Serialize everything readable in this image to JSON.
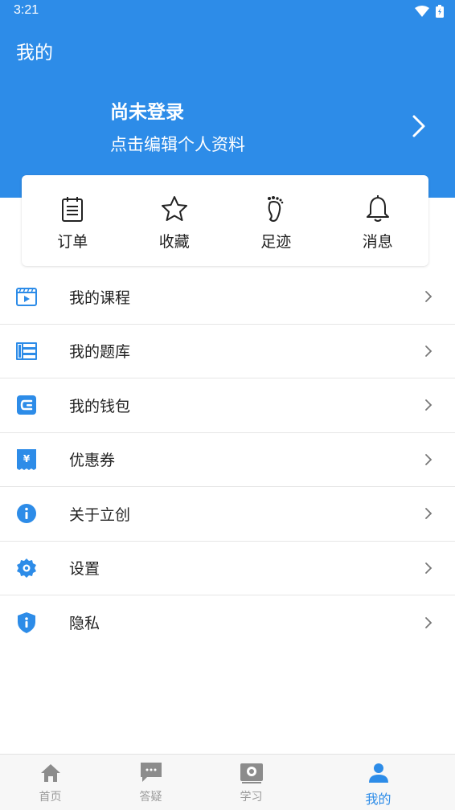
{
  "status": {
    "time": "3:21"
  },
  "header": {
    "title": "我的"
  },
  "profile": {
    "name": "尚未登录",
    "subtitle": "点击编辑个人资料"
  },
  "quick": [
    {
      "label": "订单",
      "icon": "order-icon"
    },
    {
      "label": "收藏",
      "icon": "star-icon"
    },
    {
      "label": "足迹",
      "icon": "footprint-icon"
    },
    {
      "label": "消息",
      "icon": "bell-icon"
    }
  ],
  "menu": [
    {
      "label": "我的课程",
      "icon": "course-video-icon"
    },
    {
      "label": "我的题库",
      "icon": "question-bank-icon"
    },
    {
      "label": "我的钱包",
      "icon": "wallet-icon"
    },
    {
      "label": "优惠券",
      "icon": "coupon-icon"
    },
    {
      "label": "关于立创",
      "icon": "info-icon"
    },
    {
      "label": "设置",
      "icon": "gear-icon"
    },
    {
      "label": "隐私",
      "icon": "shield-icon"
    }
  ],
  "nav": [
    {
      "label": "首页",
      "icon": "home-icon"
    },
    {
      "label": "答疑",
      "icon": "chat-icon"
    },
    {
      "label": "学习",
      "icon": "study-icon"
    },
    {
      "label": "我的",
      "icon": "person-icon",
      "active": true
    }
  ],
  "colors": {
    "primary": "#2d8ce8",
    "text": "#222222",
    "muted": "#9a9a9a",
    "divider": "#e6e6e6"
  }
}
